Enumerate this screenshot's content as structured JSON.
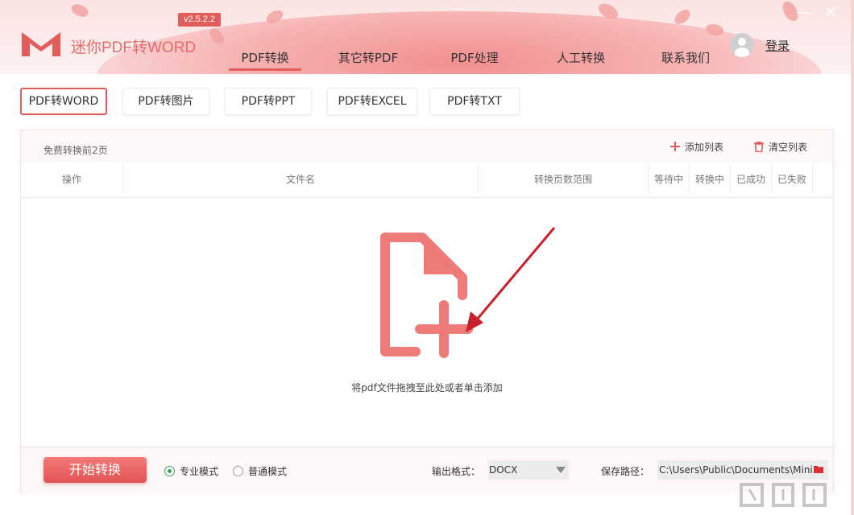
{
  "app": {
    "title": "迷你PDF转WORD",
    "version": "v2.5.2.2",
    "accent_color": "#e35c5c"
  },
  "main_nav": {
    "items": [
      {
        "label": "PDF转换",
        "active": true
      },
      {
        "label": "其它转PDF",
        "active": false
      },
      {
        "label": "PDF处理",
        "active": false
      },
      {
        "label": "人工转换",
        "active": false
      },
      {
        "label": "联系我们",
        "active": false
      }
    ]
  },
  "user": {
    "login_label": "登录",
    "avatar_icon": "user-avatar-icon"
  },
  "window_controls": {
    "minimize": "—",
    "close": "✕"
  },
  "sub_tabs": [
    {
      "label": "PDF转WORD",
      "active": true
    },
    {
      "label": "PDF转图片",
      "active": false
    },
    {
      "label": "PDF转PPT",
      "active": false
    },
    {
      "label": "PDF转EXCEL",
      "active": false
    },
    {
      "label": "PDF转TXT",
      "active": false
    }
  ],
  "list_panel": {
    "free_note": "免费转换前2页",
    "add_list_label": "添加列表",
    "clear_list_label": "清空列表",
    "columns": [
      "操作",
      "文件名",
      "转换页数范围",
      "等待中",
      "转换中",
      "已成功",
      "已失败"
    ],
    "drop_hint": "将pdf文件拖拽至此处或者单击添加",
    "drop_icon": "add-file-icon"
  },
  "bottom_bar": {
    "start_label": "开始转换",
    "modes": [
      {
        "label": "专业模式",
        "checked": true
      },
      {
        "label": "普通模式",
        "checked": false
      }
    ],
    "output_format_label": "输出格式：",
    "output_format_value": "DOCX",
    "save_path_label": "保存路径：",
    "save_path_value": "C:\\Users\\Public\\Documents\\Mini"
  }
}
